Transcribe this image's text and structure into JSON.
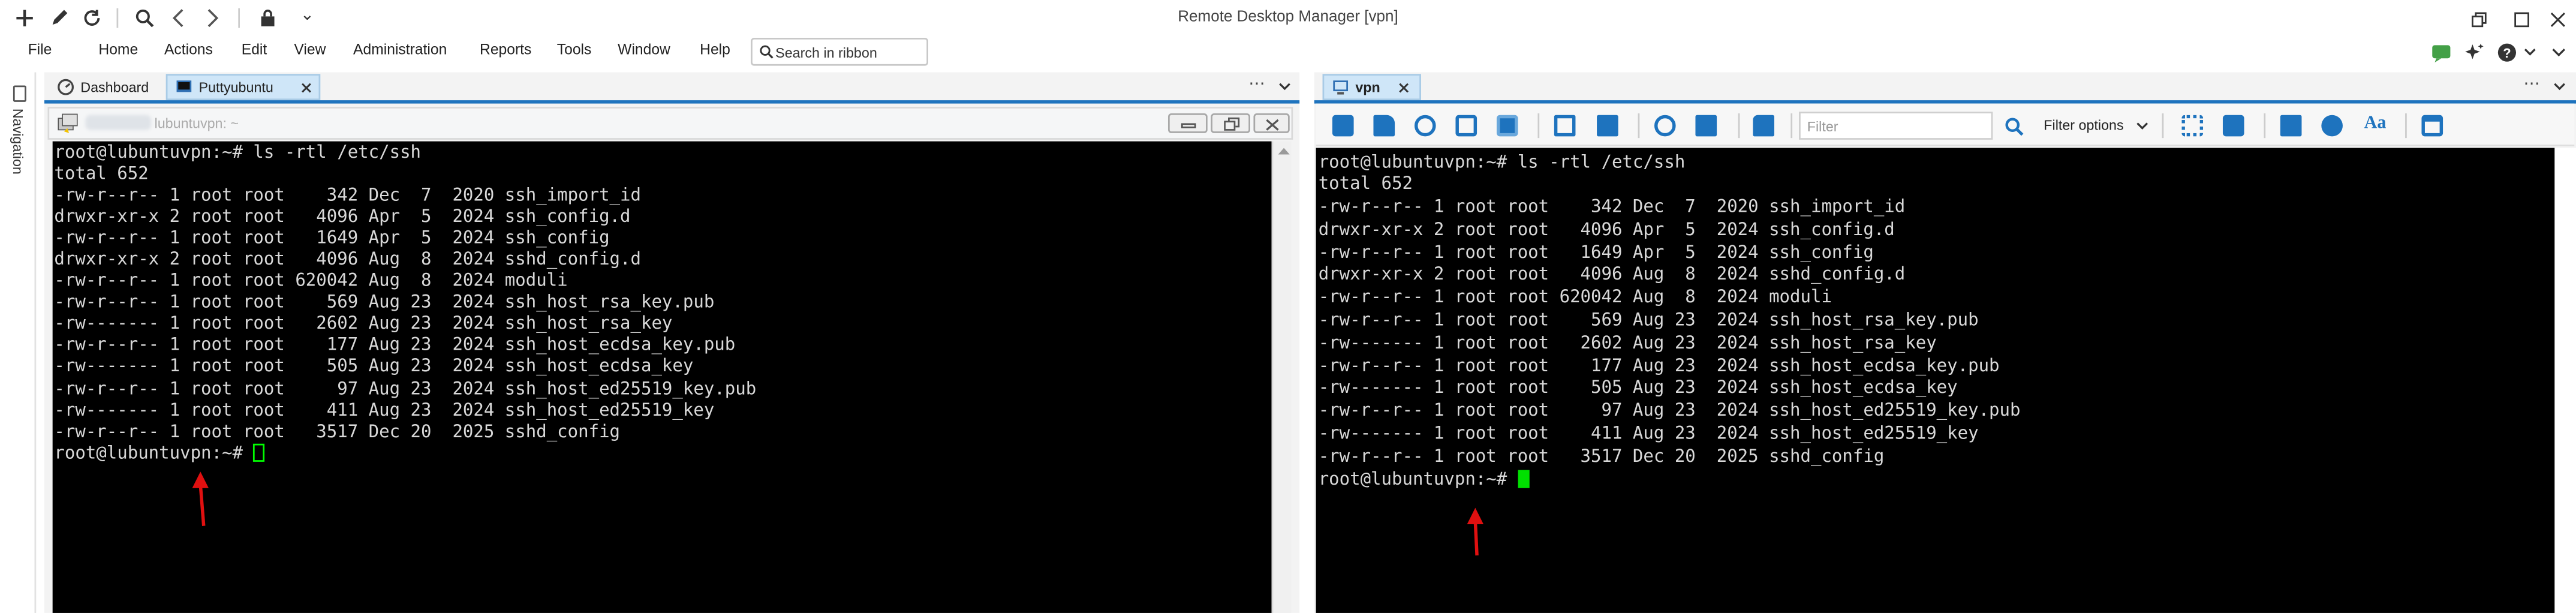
{
  "window": {
    "title": "Remote Desktop Manager [vpn]",
    "qat_dropdown": "⌄"
  },
  "menu": {
    "items": [
      "File",
      "Home",
      "Actions",
      "Edit",
      "View",
      "Administration",
      "Reports",
      "Tools",
      "Window",
      "Help"
    ],
    "search_placeholder": "Search in ribbon"
  },
  "sidebar": {
    "label": "Navigation"
  },
  "left_pane": {
    "tabs": [
      {
        "label": "Dashboard",
        "active": false
      },
      {
        "label": "Puttyubuntu",
        "active": true
      }
    ],
    "putty_title": "lubuntuvpn: ~",
    "prompt_cursor_color": "#00ff00",
    "terminal_lines": [
      "root@lubuntuvpn:~# ls -rtl /etc/ssh",
      "total 652",
      "-rw-r--r-- 1 root root    342 Dec  7  2020 ssh_import_id",
      "drwxr-xr-x 2 root root   4096 Apr  5  2024 ssh_config.d",
      "-rw-r--r-- 1 root root   1649 Apr  5  2024 ssh_config",
      "drwxr-xr-x 2 root root   4096 Aug  8  2024 sshd_config.d",
      "-rw-r--r-- 1 root root 620042 Aug  8  2024 moduli",
      "-rw-r--r-- 1 root root    569 Aug 23  2024 ssh_host_rsa_key.pub",
      "-rw------- 1 root root   2602 Aug 23  2024 ssh_host_rsa_key",
      "-rw-r--r-- 1 root root    177 Aug 23  2024 ssh_host_ecdsa_key.pub",
      "-rw------- 1 root root    505 Aug 23  2024 ssh_host_ecdsa_key",
      "-rw-r--r-- 1 root root     97 Aug 23  2024 ssh_host_ed25519_key.pub",
      "-rw------- 1 root root    411 Aug 23  2024 ssh_host_ed25519_key",
      "-rw-r--r-- 1 root root   3517 Dec 20  2025 sshd_config",
      "root@lubuntuvpn:~# "
    ]
  },
  "right_pane": {
    "tabs": [
      {
        "label": "vpn",
        "active": true
      }
    ],
    "filter_placeholder": "Filter",
    "filter_options_label": "Filter options",
    "prompt_cursor_color": "#00e000",
    "terminal_lines": [
      "root@lubuntuvpn:~# ls -rtl /etc/ssh",
      "total 652",
      "-rw-r--r-- 1 root root    342 Dec  7  2020 ssh_import_id",
      "drwxr-xr-x 2 root root   4096 Apr  5  2024 ssh_config.d",
      "-rw-r--r-- 1 root root   1649 Apr  5  2024 ssh_config",
      "drwxr-xr-x 2 root root   4096 Aug  8  2024 sshd_config.d",
      "-rw-r--r-- 1 root root 620042 Aug  8  2024 moduli",
      "-rw-r--r-- 1 root root    569 Aug 23  2024 ssh_host_rsa_key.pub",
      "-rw------- 1 root root   2602 Aug 23  2024 ssh_host_rsa_key",
      "-rw-r--r-- 1 root root    177 Aug 23  2024 ssh_host_ecdsa_key.pub",
      "-rw------- 1 root root    505 Aug 23  2024 ssh_host_ecdsa_key",
      "-rw-r--r-- 1 root root     97 Aug 23  2024 ssh_host_ed25519_key.pub",
      "-rw------- 1 root root    411 Aug 23  2024 ssh_host_ed25519_key",
      "-rw-r--r-- 1 root root   3517 Dec 20  2025 sshd_config",
      "root@lubuntuvpn:~# "
    ]
  },
  "annotations": {
    "arrow_color": "#e01010"
  },
  "colors": {
    "accent": "#1e73be",
    "active_tab": "#cfe6f8",
    "terminal_bg": "#000000",
    "terminal_fg": "#d8d8d8"
  }
}
